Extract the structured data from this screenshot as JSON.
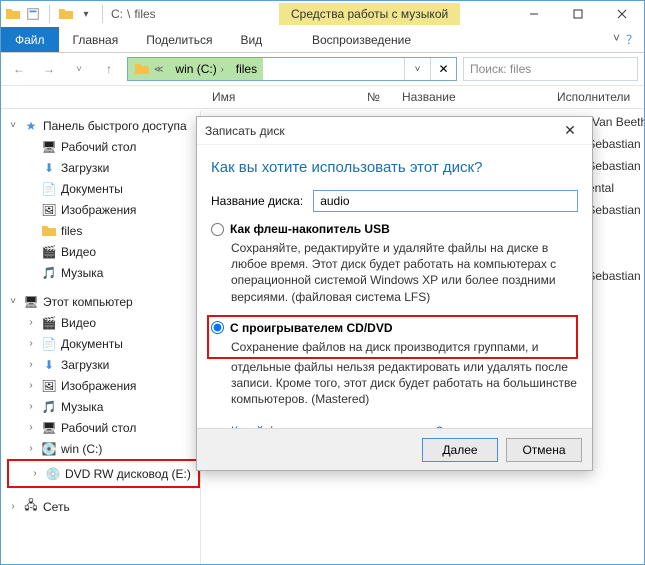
{
  "titlebar": {
    "drive": "C:",
    "folder": "files",
    "context_tab": "Средства работы с музыкой"
  },
  "ribbon": {
    "file": "Файл",
    "home": "Главная",
    "share": "Поделиться",
    "view": "Вид",
    "playback": "Воспроизведение"
  },
  "address": {
    "seg1": "win  (C:)",
    "seg2": "files"
  },
  "search": {
    "placeholder": "Поиск: files"
  },
  "columns": {
    "name": "Имя",
    "num": "№",
    "title": "Название",
    "artist": "Исполнители"
  },
  "tree": {
    "quick": "Панель быстрого доступа",
    "desktop": "Рабочий стол",
    "downloads": "Загрузки",
    "documents": "Документы",
    "pictures": "Изображения",
    "files": "files",
    "videos": "Видео",
    "music": "Музыка",
    "this_pc": "Этот компьютер",
    "pc_videos": "Видео",
    "pc_documents": "Документы",
    "pc_downloads": "Загрузки",
    "pc_pictures": "Изображения",
    "pc_music": "Музыка",
    "pc_desktop": "Рабочий стол",
    "pc_win": "win (C:)",
    "pc_dvd": "DVD RW дисковод (E:)",
    "network": "Сеть"
  },
  "artists": {
    "r0": "dwig Van Beeth…",
    "r1": "ann Sebastian …",
    "r2": "ann Sebastian …",
    "r3": "trumental",
    "r4": "ann Sebastian …",
    "r5": "ann Sebastian …"
  },
  "dialog": {
    "title": "Записать диск",
    "question": "Как вы хотите использовать этот диск?",
    "disc_label": "Название диска:",
    "disc_value": "audio",
    "opt1_title": "Как флеш-накопитель USB",
    "opt1_desc": "Сохраняйте, редактируйте и удаляйте файлы на диске в любое время. Этот диск будет работать на компьютерах с операционной системой Windows XP или более поздними версиями. (файловая система LFS)",
    "opt2_title": "С проигрывателем CD/DVD",
    "opt2_desc": "Сохранение файлов на диск производится группами, и отдельные файлы нельзя редактировать или удалять после записи. Кроме того, этот диск будет работать на большинстве компьютеров. (Mastered)",
    "help_link": "Какой формат следует использовать?",
    "next": "Далее",
    "cancel": "Отмена"
  }
}
